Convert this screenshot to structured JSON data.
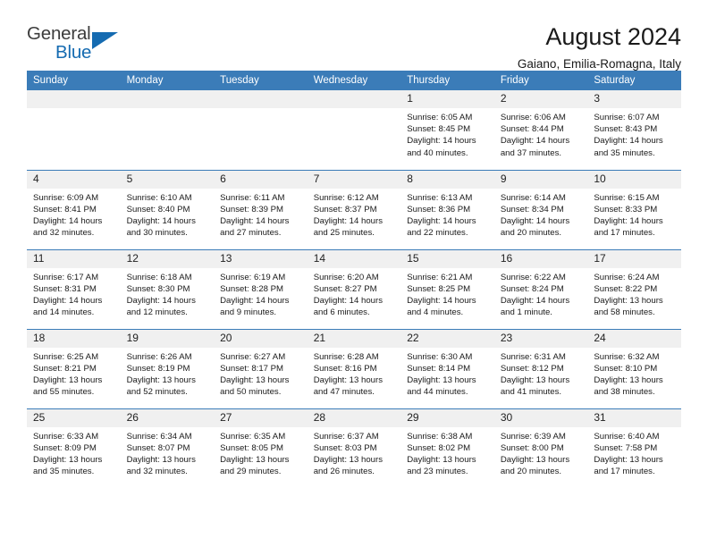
{
  "logo": {
    "word_top": "General",
    "word_bottom": "Blue",
    "accent_color": "#156bb1"
  },
  "header": {
    "title": "August 2024",
    "subtitle": "Gaiano, Emilia-Romagna, Italy"
  },
  "calendar": {
    "header_bg": "#3b7cb8",
    "daynum_bg": "#f0f0f0",
    "weekdays": [
      "Sunday",
      "Monday",
      "Tuesday",
      "Wednesday",
      "Thursday",
      "Friday",
      "Saturday"
    ],
    "weeks": [
      [
        {
          "day": "",
          "empty": true
        },
        {
          "day": "",
          "empty": true
        },
        {
          "day": "",
          "empty": true
        },
        {
          "day": "",
          "empty": true
        },
        {
          "day": "1",
          "sunrise": "Sunrise: 6:05 AM",
          "sunset": "Sunset: 8:45 PM",
          "daylight": "Daylight: 14 hours and 40 minutes."
        },
        {
          "day": "2",
          "sunrise": "Sunrise: 6:06 AM",
          "sunset": "Sunset: 8:44 PM",
          "daylight": "Daylight: 14 hours and 37 minutes."
        },
        {
          "day": "3",
          "sunrise": "Sunrise: 6:07 AM",
          "sunset": "Sunset: 8:43 PM",
          "daylight": "Daylight: 14 hours and 35 minutes."
        }
      ],
      [
        {
          "day": "4",
          "sunrise": "Sunrise: 6:09 AM",
          "sunset": "Sunset: 8:41 PM",
          "daylight": "Daylight: 14 hours and 32 minutes."
        },
        {
          "day": "5",
          "sunrise": "Sunrise: 6:10 AM",
          "sunset": "Sunset: 8:40 PM",
          "daylight": "Daylight: 14 hours and 30 minutes."
        },
        {
          "day": "6",
          "sunrise": "Sunrise: 6:11 AM",
          "sunset": "Sunset: 8:39 PM",
          "daylight": "Daylight: 14 hours and 27 minutes."
        },
        {
          "day": "7",
          "sunrise": "Sunrise: 6:12 AM",
          "sunset": "Sunset: 8:37 PM",
          "daylight": "Daylight: 14 hours and 25 minutes."
        },
        {
          "day": "8",
          "sunrise": "Sunrise: 6:13 AM",
          "sunset": "Sunset: 8:36 PM",
          "daylight": "Daylight: 14 hours and 22 minutes."
        },
        {
          "day": "9",
          "sunrise": "Sunrise: 6:14 AM",
          "sunset": "Sunset: 8:34 PM",
          "daylight": "Daylight: 14 hours and 20 minutes."
        },
        {
          "day": "10",
          "sunrise": "Sunrise: 6:15 AM",
          "sunset": "Sunset: 8:33 PM",
          "daylight": "Daylight: 14 hours and 17 minutes."
        }
      ],
      [
        {
          "day": "11",
          "sunrise": "Sunrise: 6:17 AM",
          "sunset": "Sunset: 8:31 PM",
          "daylight": "Daylight: 14 hours and 14 minutes."
        },
        {
          "day": "12",
          "sunrise": "Sunrise: 6:18 AM",
          "sunset": "Sunset: 8:30 PM",
          "daylight": "Daylight: 14 hours and 12 minutes."
        },
        {
          "day": "13",
          "sunrise": "Sunrise: 6:19 AM",
          "sunset": "Sunset: 8:28 PM",
          "daylight": "Daylight: 14 hours and 9 minutes."
        },
        {
          "day": "14",
          "sunrise": "Sunrise: 6:20 AM",
          "sunset": "Sunset: 8:27 PM",
          "daylight": "Daylight: 14 hours and 6 minutes."
        },
        {
          "day": "15",
          "sunrise": "Sunrise: 6:21 AM",
          "sunset": "Sunset: 8:25 PM",
          "daylight": "Daylight: 14 hours and 4 minutes."
        },
        {
          "day": "16",
          "sunrise": "Sunrise: 6:22 AM",
          "sunset": "Sunset: 8:24 PM",
          "daylight": "Daylight: 14 hours and 1 minute."
        },
        {
          "day": "17",
          "sunrise": "Sunrise: 6:24 AM",
          "sunset": "Sunset: 8:22 PM",
          "daylight": "Daylight: 13 hours and 58 minutes."
        }
      ],
      [
        {
          "day": "18",
          "sunrise": "Sunrise: 6:25 AM",
          "sunset": "Sunset: 8:21 PM",
          "daylight": "Daylight: 13 hours and 55 minutes."
        },
        {
          "day": "19",
          "sunrise": "Sunrise: 6:26 AM",
          "sunset": "Sunset: 8:19 PM",
          "daylight": "Daylight: 13 hours and 52 minutes."
        },
        {
          "day": "20",
          "sunrise": "Sunrise: 6:27 AM",
          "sunset": "Sunset: 8:17 PM",
          "daylight": "Daylight: 13 hours and 50 minutes."
        },
        {
          "day": "21",
          "sunrise": "Sunrise: 6:28 AM",
          "sunset": "Sunset: 8:16 PM",
          "daylight": "Daylight: 13 hours and 47 minutes."
        },
        {
          "day": "22",
          "sunrise": "Sunrise: 6:30 AM",
          "sunset": "Sunset: 8:14 PM",
          "daylight": "Daylight: 13 hours and 44 minutes."
        },
        {
          "day": "23",
          "sunrise": "Sunrise: 6:31 AM",
          "sunset": "Sunset: 8:12 PM",
          "daylight": "Daylight: 13 hours and 41 minutes."
        },
        {
          "day": "24",
          "sunrise": "Sunrise: 6:32 AM",
          "sunset": "Sunset: 8:10 PM",
          "daylight": "Daylight: 13 hours and 38 minutes."
        }
      ],
      [
        {
          "day": "25",
          "sunrise": "Sunrise: 6:33 AM",
          "sunset": "Sunset: 8:09 PM",
          "daylight": "Daylight: 13 hours and 35 minutes."
        },
        {
          "day": "26",
          "sunrise": "Sunrise: 6:34 AM",
          "sunset": "Sunset: 8:07 PM",
          "daylight": "Daylight: 13 hours and 32 minutes."
        },
        {
          "day": "27",
          "sunrise": "Sunrise: 6:35 AM",
          "sunset": "Sunset: 8:05 PM",
          "daylight": "Daylight: 13 hours and 29 minutes."
        },
        {
          "day": "28",
          "sunrise": "Sunrise: 6:37 AM",
          "sunset": "Sunset: 8:03 PM",
          "daylight": "Daylight: 13 hours and 26 minutes."
        },
        {
          "day": "29",
          "sunrise": "Sunrise: 6:38 AM",
          "sunset": "Sunset: 8:02 PM",
          "daylight": "Daylight: 13 hours and 23 minutes."
        },
        {
          "day": "30",
          "sunrise": "Sunrise: 6:39 AM",
          "sunset": "Sunset: 8:00 PM",
          "daylight": "Daylight: 13 hours and 20 minutes."
        },
        {
          "day": "31",
          "sunrise": "Sunrise: 6:40 AM",
          "sunset": "Sunset: 7:58 PM",
          "daylight": "Daylight: 13 hours and 17 minutes."
        }
      ]
    ]
  }
}
